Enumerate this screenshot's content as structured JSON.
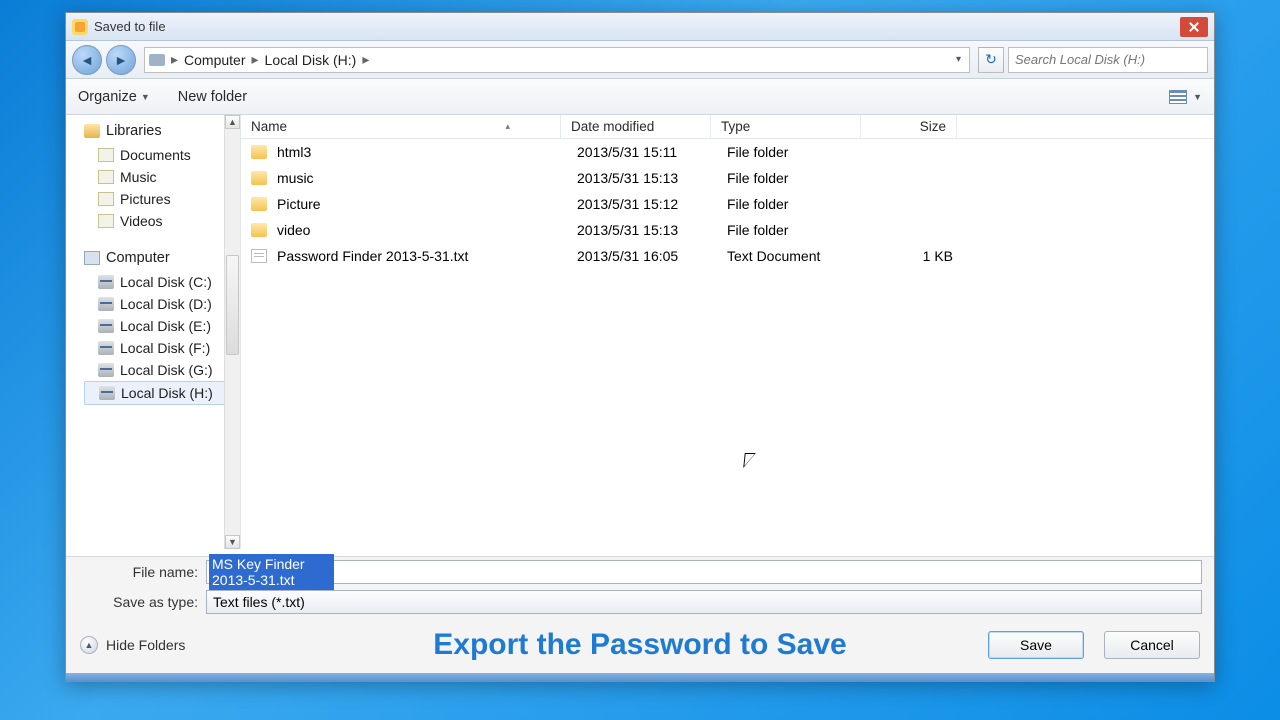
{
  "window": {
    "title": "Saved to file"
  },
  "breadcrumbs": {
    "root": "Computer",
    "drive": "Local Disk (H:)"
  },
  "search": {
    "placeholder": "Search Local Disk (H:)"
  },
  "toolbar": {
    "organize": "Organize",
    "newfolder": "New folder"
  },
  "sidebar": {
    "libraries": {
      "label": "Libraries",
      "items": [
        "Documents",
        "Music",
        "Pictures",
        "Videos"
      ]
    },
    "computer": {
      "label": "Computer",
      "drives": [
        "Local Disk (C:)",
        "Local Disk (D:)",
        "Local Disk (E:)",
        "Local Disk (F:)",
        "Local Disk (G:)",
        "Local Disk (H:)"
      ]
    }
  },
  "columns": {
    "name": "Name",
    "date": "Date modified",
    "type": "Type",
    "size": "Size"
  },
  "files": [
    {
      "name": "html3",
      "date": "2013/5/31 15:11",
      "type": "File folder",
      "size": "",
      "icon": "folder"
    },
    {
      "name": "music",
      "date": "2013/5/31 15:13",
      "type": "File folder",
      "size": "",
      "icon": "folder"
    },
    {
      "name": "Picture",
      "date": "2013/5/31 15:12",
      "type": "File folder",
      "size": "",
      "icon": "folder"
    },
    {
      "name": "video",
      "date": "2013/5/31 15:13",
      "type": "File folder",
      "size": "",
      "icon": "folder"
    },
    {
      "name": "Password Finder 2013-5-31.txt",
      "date": "2013/5/31 16:05",
      "type": "Text Document",
      "size": "1 KB",
      "icon": "txt"
    }
  ],
  "form": {
    "filename_label": "File name:",
    "filename_value": "MS Key Finder 2013-5-31.txt",
    "type_label": "Save as type:",
    "type_value": "Text files (*.txt)"
  },
  "footer": {
    "hide_folders": "Hide Folders",
    "overlay": "Export the  Password to Save",
    "save": "Save",
    "cancel": "Cancel"
  }
}
